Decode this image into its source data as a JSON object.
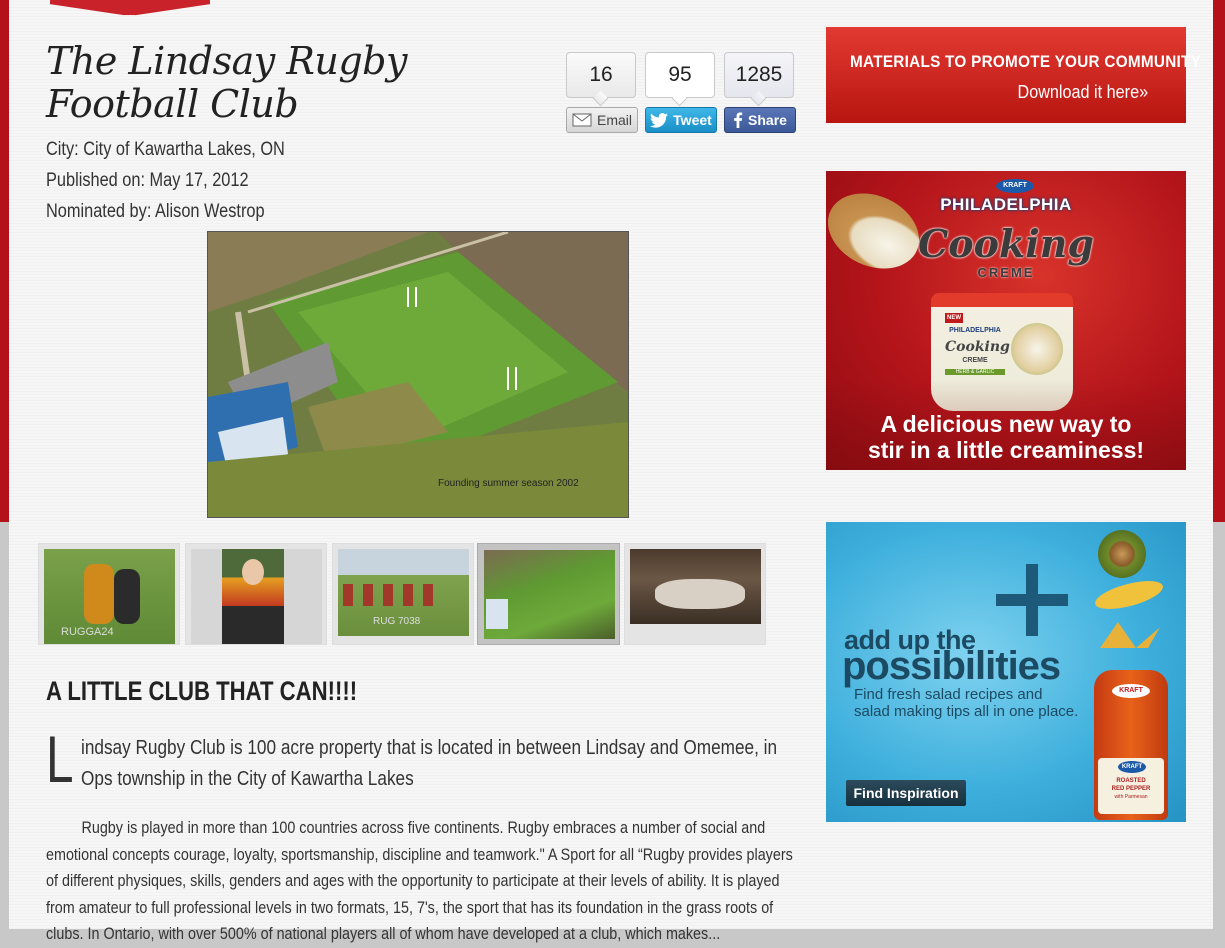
{
  "article": {
    "title": "The Lindsay Rugby Football Club",
    "city": "City: City of Kawartha Lakes, ON",
    "published": "Published on: May 17, 2012",
    "nominated": "Nominated by: Alison Westrop"
  },
  "social": {
    "email_count": "16",
    "tweet_count": "95",
    "share_count": "1285",
    "email_label": "Email",
    "tweet_label": "Tweet",
    "share_label": "Share"
  },
  "photo": {
    "caption": "Founding summer season 2002"
  },
  "thumbnails": [
    {
      "label": "RUGGA24"
    },
    {
      "label": ""
    },
    {
      "label": "RUG 7038"
    },
    {
      "label": ""
    },
    {
      "label": ""
    }
  ],
  "content": {
    "heading": "A LITTLE CLUB THAT CAN!!!!",
    "dropcap": "L",
    "lead": "indsay Rugby Club is 100 acre property that is located in between Lindsay and Omemee, in Ops township in the City of Kawartha Lakes",
    "body": "Rugby is played in more than 100 countries across five continents. Rugby embraces a number of social and emotional concepts courage, loyalty, sportsmanship, discipline and teamwork.\" A Sport for all “Rugby provides players of different physiques, skills, genders and ages with the opportunity to participate at their levels of ability. It is played from amateur to full professional levels in two formats, 15, 7's, the sport that has its foundation in the grass roots of clubs. In Ontario, with over 500% of national players all of whom have developed at a club, which makes..."
  },
  "promo": {
    "title": "MATERIALS TO PROMOTE YOUR COMMUNITY",
    "link": "Download it here»"
  },
  "ad_philadelphia": {
    "brand": "PHILADELPHIA",
    "product": "Cooking",
    "product_sub": "CREME",
    "badge": "KRAFT",
    "new_label": "NEW",
    "tub_brand": "PHILADELPHIA",
    "tub_product": "Cooking",
    "tub_sub": "CREME",
    "tub_flavour": "HERB & GARLIC",
    "tagline_1": "A delicious new way to",
    "tagline_2": "stir in a little creaminess!"
  },
  "ad_kraft": {
    "headline_1": "add up the",
    "headline_2": "possibilities",
    "sub_1": "Find fresh salad recipes and",
    "sub_2": "salad making tips all in one place.",
    "button": "Find Inspiration",
    "bottle_brand": "KRAFT",
    "bottle_label_1": "ROASTED",
    "bottle_label_2": "RED PEPPER",
    "bottle_label_3": "with Parmesan"
  },
  "colors": {
    "brand_red": "#b3121b",
    "promo_red": "#d42a24",
    "twitter_blue": "#1a8fc6",
    "facebook_blue": "#3b5998",
    "ad_blue": "#3fb0dd"
  }
}
